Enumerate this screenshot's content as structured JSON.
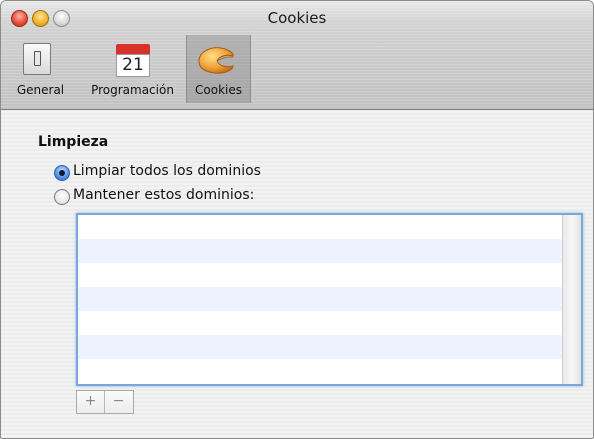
{
  "window": {
    "title": "Cookies"
  },
  "toolbar": {
    "items": [
      {
        "label": "General",
        "icon": "switch-icon"
      },
      {
        "label": "Programación",
        "icon": "calendar-icon",
        "calendar_day": "21"
      },
      {
        "label": "Cookies",
        "icon": "fortune-cookie-icon",
        "selected": true
      }
    ]
  },
  "cleanup": {
    "title": "Limpieza",
    "options": [
      {
        "label": "Limpiar todos los dominios",
        "selected": true
      },
      {
        "label": "Mantener estos dominios:",
        "selected": false
      }
    ]
  },
  "domains_list": {
    "items": []
  },
  "list_buttons": {
    "add": "+",
    "remove": "−"
  },
  "colors": {
    "selection_blue": "#2a63c8",
    "list_alt_row": "#edf3fe",
    "calendar_red": "#d8312b"
  }
}
